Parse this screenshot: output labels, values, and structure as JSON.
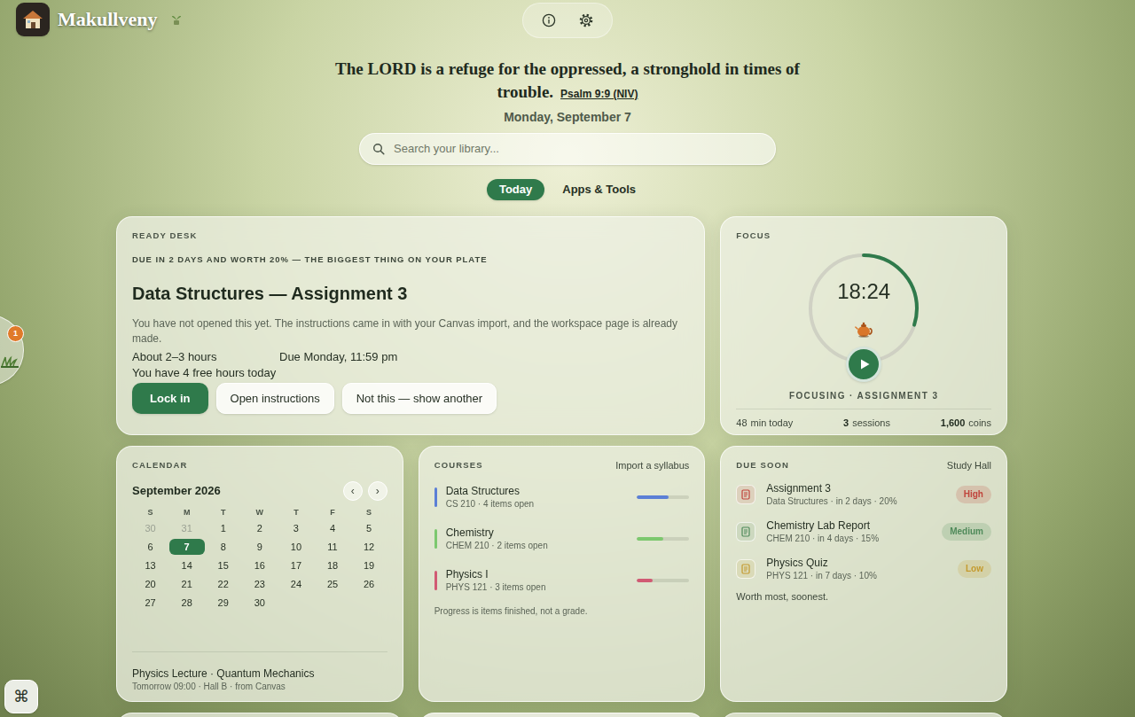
{
  "app": {
    "name": "Makullveny"
  },
  "verse": {
    "text": "The LORD is a refuge for the oppressed, a stronghold in times of trouble.",
    "reference": "Psalm 9:9 (NIV)"
  },
  "date": "Monday, September 7",
  "search": {
    "placeholder": "Search your library..."
  },
  "tabs": [
    {
      "label": "Today",
      "selected": true
    },
    {
      "label": "Apps & Tools",
      "selected": false
    }
  ],
  "side_widget": {
    "badge": "1"
  },
  "command_button": {
    "label": "⌘"
  },
  "ready_desk": {
    "label": "READY DESK",
    "kicker": "DUE IN 2 DAYS AND WORTH 20% — THE BIGGEST THING ON YOUR PLATE",
    "title": "Data Structures — Assignment 3",
    "description": "You have not opened this yet. The instructions came in with your Canvas import, and the workspace page is already made.",
    "estimate": "About 2–3 hours",
    "due": "Due Monday, 11:59 pm",
    "free_time": "You have 4 free hours today",
    "buttons": [
      {
        "label": "Lock in",
        "kind": "primary"
      },
      {
        "label": "Open instructions",
        "kind": "secondary"
      },
      {
        "label": "Not this — show another",
        "kind": "secondary"
      }
    ]
  },
  "focus": {
    "label": "FOCUS",
    "time": "18:24",
    "level": 0.3,
    "status": "FOCUSING · ASSIGNMENT 3",
    "stats": [
      {
        "value": "48",
        "label": "min today"
      },
      {
        "value": "3",
        "label": "sessions"
      },
      {
        "value": "1,600",
        "label": "coins"
      }
    ]
  },
  "calendar": {
    "label": "CALENDAR",
    "month": "September 2026",
    "prev": "‹",
    "next": "›",
    "weekdays": [
      "S",
      "M",
      "T",
      "W",
      "T",
      "F",
      "S"
    ],
    "days": [
      {
        "day": "30",
        "muted": true,
        "selected": false
      },
      {
        "day": "31",
        "muted": true,
        "selected": false
      },
      {
        "day": "1",
        "muted": false,
        "selected": false
      },
      {
        "day": "2",
        "muted": false,
        "selected": false
      },
      {
        "day": "3",
        "muted": false,
        "selected": false
      },
      {
        "day": "4",
        "muted": false,
        "selected": false
      },
      {
        "day": "5",
        "muted": false,
        "selected": false
      },
      {
        "day": "6",
        "muted": false,
        "selected": false
      },
      {
        "day": "7",
        "muted": false,
        "selected": true
      },
      {
        "day": "8",
        "muted": false,
        "selected": false
      },
      {
        "day": "9",
        "muted": false,
        "selected": false
      },
      {
        "day": "10",
        "muted": false,
        "selected": false
      },
      {
        "day": "11",
        "muted": false,
        "selected": false
      },
      {
        "day": "12",
        "muted": false,
        "selected": false
      },
      {
        "day": "13",
        "muted": false,
        "selected": false
      },
      {
        "day": "14",
        "muted": false,
        "selected": false
      },
      {
        "day": "15",
        "muted": false,
        "selected": false
      },
      {
        "day": "16",
        "muted": false,
        "selected": false
      },
      {
        "day": "17",
        "muted": false,
        "selected": false
      },
      {
        "day": "18",
        "muted": false,
        "selected": false
      },
      {
        "day": "19",
        "muted": false,
        "selected": false
      },
      {
        "day": "20",
        "muted": false,
        "selected": false
      },
      {
        "day": "21",
        "muted": false,
        "selected": false
      },
      {
        "day": "22",
        "muted": false,
        "selected": false
      },
      {
        "day": "23",
        "muted": false,
        "selected": false
      },
      {
        "day": "24",
        "muted": false,
        "selected": false
      },
      {
        "day": "25",
        "muted": false,
        "selected": false
      },
      {
        "day": "26",
        "muted": false,
        "selected": false
      },
      {
        "day": "27",
        "muted": false,
        "selected": false
      },
      {
        "day": "28",
        "muted": false,
        "selected": false
      },
      {
        "day": "29",
        "muted": false,
        "selected": false
      },
      {
        "day": "30",
        "muted": false,
        "selected": false
      }
    ],
    "event": {
      "title": "Physics Lecture · Quantum Mechanics",
      "detail": "Tomorrow 09:00 · Hall B · from Canvas"
    }
  },
  "courses": {
    "label": "COURSES",
    "action": "Import a syllabus",
    "items": [
      {
        "name": "Data Structures",
        "detail": "CS 210 · 4 items open",
        "level": 0.6,
        "color": "#5b7fd6"
      },
      {
        "name": "Chemistry",
        "detail": "CHEM 210 · 2 items open",
        "level": 0.5,
        "color": "#7cc86e"
      },
      {
        "name": "Physics I",
        "detail": "PHYS 121 · 3 items open",
        "level": 0.3,
        "color": "#d15a73"
      }
    ],
    "note": "Progress is items finished, not a grade."
  },
  "due_soon": {
    "label": "DUE SOON",
    "action": "Study Hall",
    "items": [
      {
        "title": "Assignment 3",
        "detail": "Data Structures · in 2 days · 20%",
        "priority": "High",
        "color": "#c0443c"
      },
      {
        "title": "Chemistry Lab Report",
        "detail": "CHEM 210 · in 4 days · 15%",
        "priority": "Medium",
        "color": "#4f8a5a"
      },
      {
        "title": "Physics Quiz",
        "detail": "PHYS 121 · in 7 days · 10%",
        "priority": "Low",
        "color": "#c49a2e"
      }
    ],
    "note": "Worth most, soonest."
  }
}
